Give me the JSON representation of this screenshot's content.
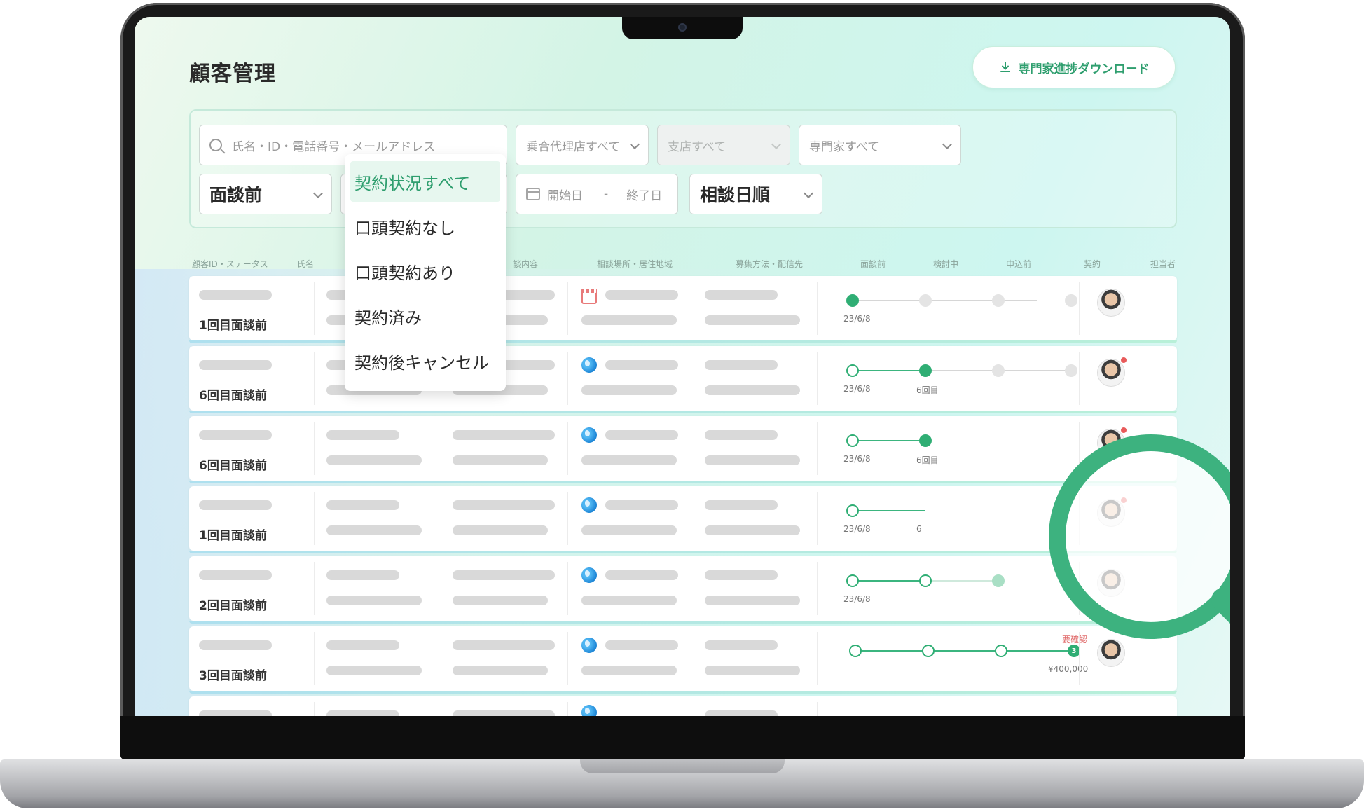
{
  "page": {
    "title": "顧客管理",
    "download_label": "専門家進捗ダウンロード"
  },
  "filters": {
    "search_placeholder": "氏名・ID・電話番号・メールアドレス",
    "agency": "乗合代理店すべて",
    "branch": "支店すべて",
    "expert": "専門家すべて",
    "status": "面談前",
    "start_date": "開始日",
    "date_sep": "-",
    "end_date": "終了日",
    "sort": "相談日順"
  },
  "contract_dropdown": {
    "options": [
      "契約状況すべて",
      "口頭契約なし",
      "口頭契約あり",
      "契約済み",
      "契約後キャンセル"
    ],
    "selected": "契約状況すべて"
  },
  "table": {
    "headers": {
      "id_status": "顧客ID・ステータス",
      "name": "氏名",
      "content": "談内容",
      "location": "相談場所・居住地域",
      "method": "募集方法・配信先",
      "stage1": "面談前",
      "stage2": "検討中",
      "stage3": "申込前",
      "stage4": "契約",
      "owner": "担当者"
    },
    "rows": [
      {
        "status": "1回目面談前",
        "location_icon": "shop-icon",
        "stage_labels": [
          "23/6/8"
        ],
        "notify": false
      },
      {
        "status": "6回目面談前",
        "location_icon": "globe-icon",
        "stage_labels": [
          "23/6/8",
          "6回目"
        ],
        "notify": true
      },
      {
        "status": "6回目面談前",
        "location_icon": "globe-icon",
        "stage_labels": [
          "23/6/8",
          "6回目"
        ],
        "notify": true
      },
      {
        "status": "1回目面談前",
        "location_icon": "globe-icon",
        "stage_labels": [
          "23/6/8",
          "6"
        ],
        "notify": true
      },
      {
        "status": "2回目面談前",
        "location_icon": "globe-icon",
        "stage_labels": [
          "23/6/8"
        ],
        "notify": false
      },
      {
        "status": "3回目面談前",
        "location_icon": "globe-icon",
        "stage_labels": [],
        "notify": false,
        "needs_check": "要確認",
        "contract_count": "3",
        "amount": "¥400,000"
      }
    ]
  },
  "colors": {
    "accent": "#2fae74",
    "alert": "#e06a6a"
  }
}
